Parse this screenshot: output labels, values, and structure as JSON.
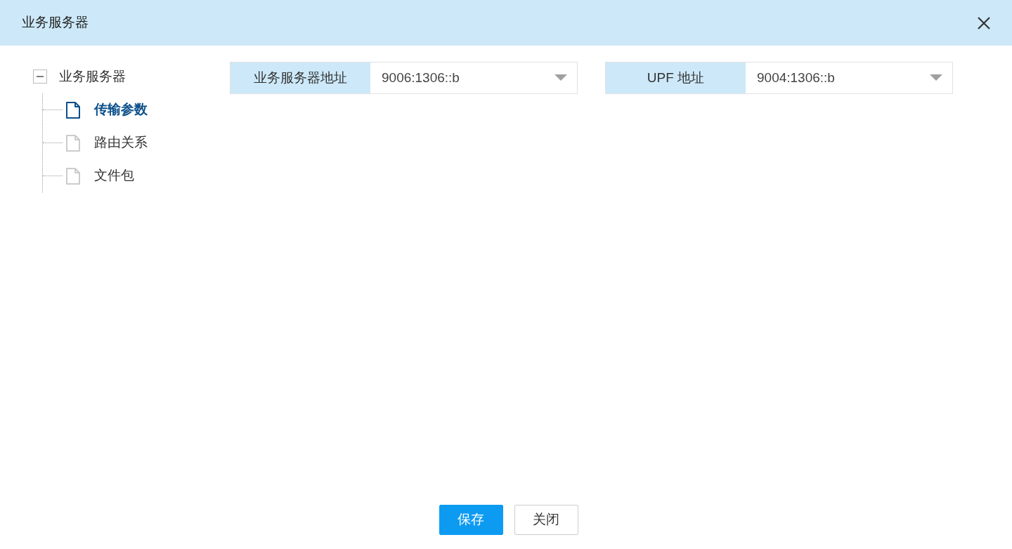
{
  "window": {
    "title": "业务服务器"
  },
  "tree": {
    "label": "业务服务器",
    "expanded": true,
    "children": [
      {
        "label": "传输参数",
        "selected": true
      },
      {
        "label": "路由关系",
        "selected": false
      },
      {
        "label": "文件包",
        "selected": false
      }
    ]
  },
  "fields": [
    {
      "label": "业务服务器地址",
      "value": "9006:1306::b"
    },
    {
      "label": "UPF 地址",
      "value": "9004:1306::b"
    }
  ],
  "buttons": [
    {
      "label": "保存",
      "kind": "primary"
    },
    {
      "label": "关闭",
      "kind": "secondary"
    }
  ]
}
